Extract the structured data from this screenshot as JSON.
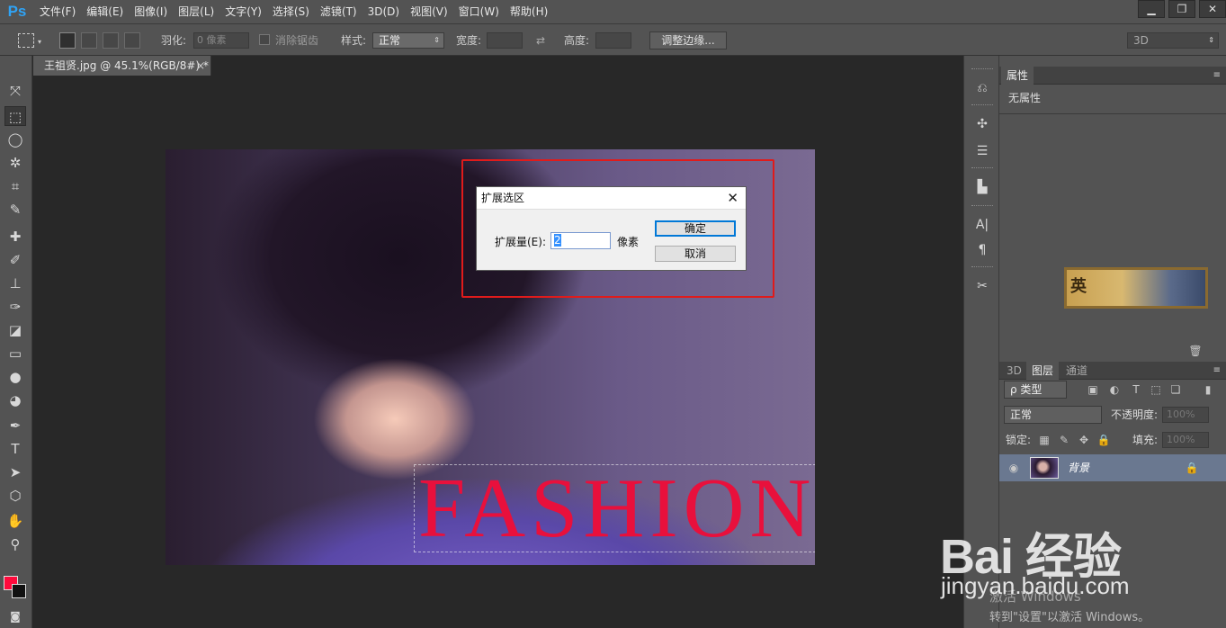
{
  "app": {
    "logo": "Ps",
    "menu": [
      "文件(F)",
      "编辑(E)",
      "图像(I)",
      "图层(L)",
      "文字(Y)",
      "选择(S)",
      "滤镜(T)",
      "3D(D)",
      "视图(V)",
      "窗口(W)",
      "帮助(H)"
    ],
    "window_controls": [
      "minimize",
      "restore",
      "close"
    ]
  },
  "options_bar": {
    "feather_label": "羽化:",
    "feather_value": "0 像素",
    "antialias_label": "消除锯齿",
    "style_label": "样式:",
    "style_value": "正常",
    "width_label": "宽度:",
    "height_label": "高度:",
    "refine_button": "调整边缘...",
    "workspace_value": "3D"
  },
  "document": {
    "tab_title": "王祖贤.jpg @ 45.1%(RGB/8#) *",
    "canvas_text": "FASHION"
  },
  "dialog": {
    "title": "扩展选区",
    "amount_label": "扩展量(E):",
    "amount_value": "2",
    "unit": "像素",
    "ok": "确定",
    "cancel": "取消"
  },
  "properties_panel": {
    "tab": "属性",
    "empty_text": "无属性",
    "banner_char": "英"
  },
  "layers_panel": {
    "tabs": [
      "3D",
      "图层",
      "通道"
    ],
    "active_tab": "图层",
    "filter_label": "ρ 类型",
    "blend_mode": "正常",
    "opacity_label": "不透明度:",
    "opacity_value": "100%",
    "lock_label": "锁定:",
    "fill_label": "填充:",
    "fill_value": "100%",
    "layers": [
      {
        "name": "背景",
        "locked": true,
        "visible": true
      }
    ]
  },
  "colors": {
    "foreground": "#ff0a3c",
    "background": "#111111",
    "highlight": "#e01b1b"
  },
  "watermark": {
    "brand": "Bai 经验",
    "site": "jingyan.baidu.com",
    "activate_line1": "激活 Windows",
    "activate_line2": "转到\"设置\"以激活 Windows。"
  }
}
